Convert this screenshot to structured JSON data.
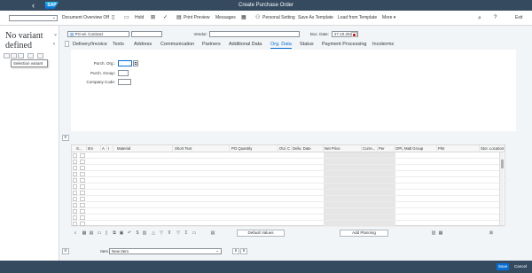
{
  "shell": {
    "title": "Create Purchase Order",
    "logo": "SAP",
    "back_icon": "‹",
    "search_icon": "⌕",
    "help_icon": "?",
    "exit_label": "Exit"
  },
  "toolbar": {
    "dropdown_value": "",
    "doc_overview": "Document Overview Off",
    "hold": "Hold",
    "print_preview": "Print Preview",
    "messages": "Messages",
    "personal_setting": "Personal Setting",
    "save_as_template": "Save As Template",
    "load_from_template": "Load from Template",
    "more": "More ▾"
  },
  "left_panel": {
    "no_variant": "No variant defined",
    "tooltip": "Selection variant"
  },
  "header": {
    "doc_type": "PO wt. Contract",
    "doc_number": "",
    "vendor_label": "Vendor:",
    "vendor_value": "",
    "doc_date_label": "Doc. Date:",
    "doc_date_value": "27.10.2021"
  },
  "tabs": [
    {
      "label": "Delivery/Invoice"
    },
    {
      "label": "Texts"
    },
    {
      "label": "Address"
    },
    {
      "label": "Communication"
    },
    {
      "label": "Partners"
    },
    {
      "label": "Additional Data"
    },
    {
      "label": "Org. Data"
    },
    {
      "label": "Status"
    },
    {
      "label": "Payment Processing"
    },
    {
      "label": "Incoterms"
    }
  ],
  "org_data": {
    "purch_org_label": "Purch. Org.:",
    "purch_org_value": "",
    "purch_group_label": "Purch. Group:",
    "purch_group_value": "",
    "company_code_label": "Company Code:",
    "company_code_value": ""
  },
  "item_grid": {
    "columns": [
      "S...",
      "Itm",
      "A",
      "I",
      "Material",
      "Short Text",
      "PO Quantity",
      "OUn",
      "C",
      "Deliv. Date",
      "Net Price",
      "Curre...",
      "Per",
      "OPU",
      "Matl Group",
      "Plnt",
      "Stor. Location"
    ],
    "default_values_label": "Default Values",
    "add_planning_label": "Add Planning"
  },
  "item_bar": {
    "item_label": "Item",
    "item_value": "New Item"
  },
  "footer": {
    "save_label": "Save",
    "cancel_label": "Cancel"
  },
  "colors": {
    "shell": "#354a5f",
    "accent": "#0a6ed1",
    "error_marker": "#bb0000"
  }
}
